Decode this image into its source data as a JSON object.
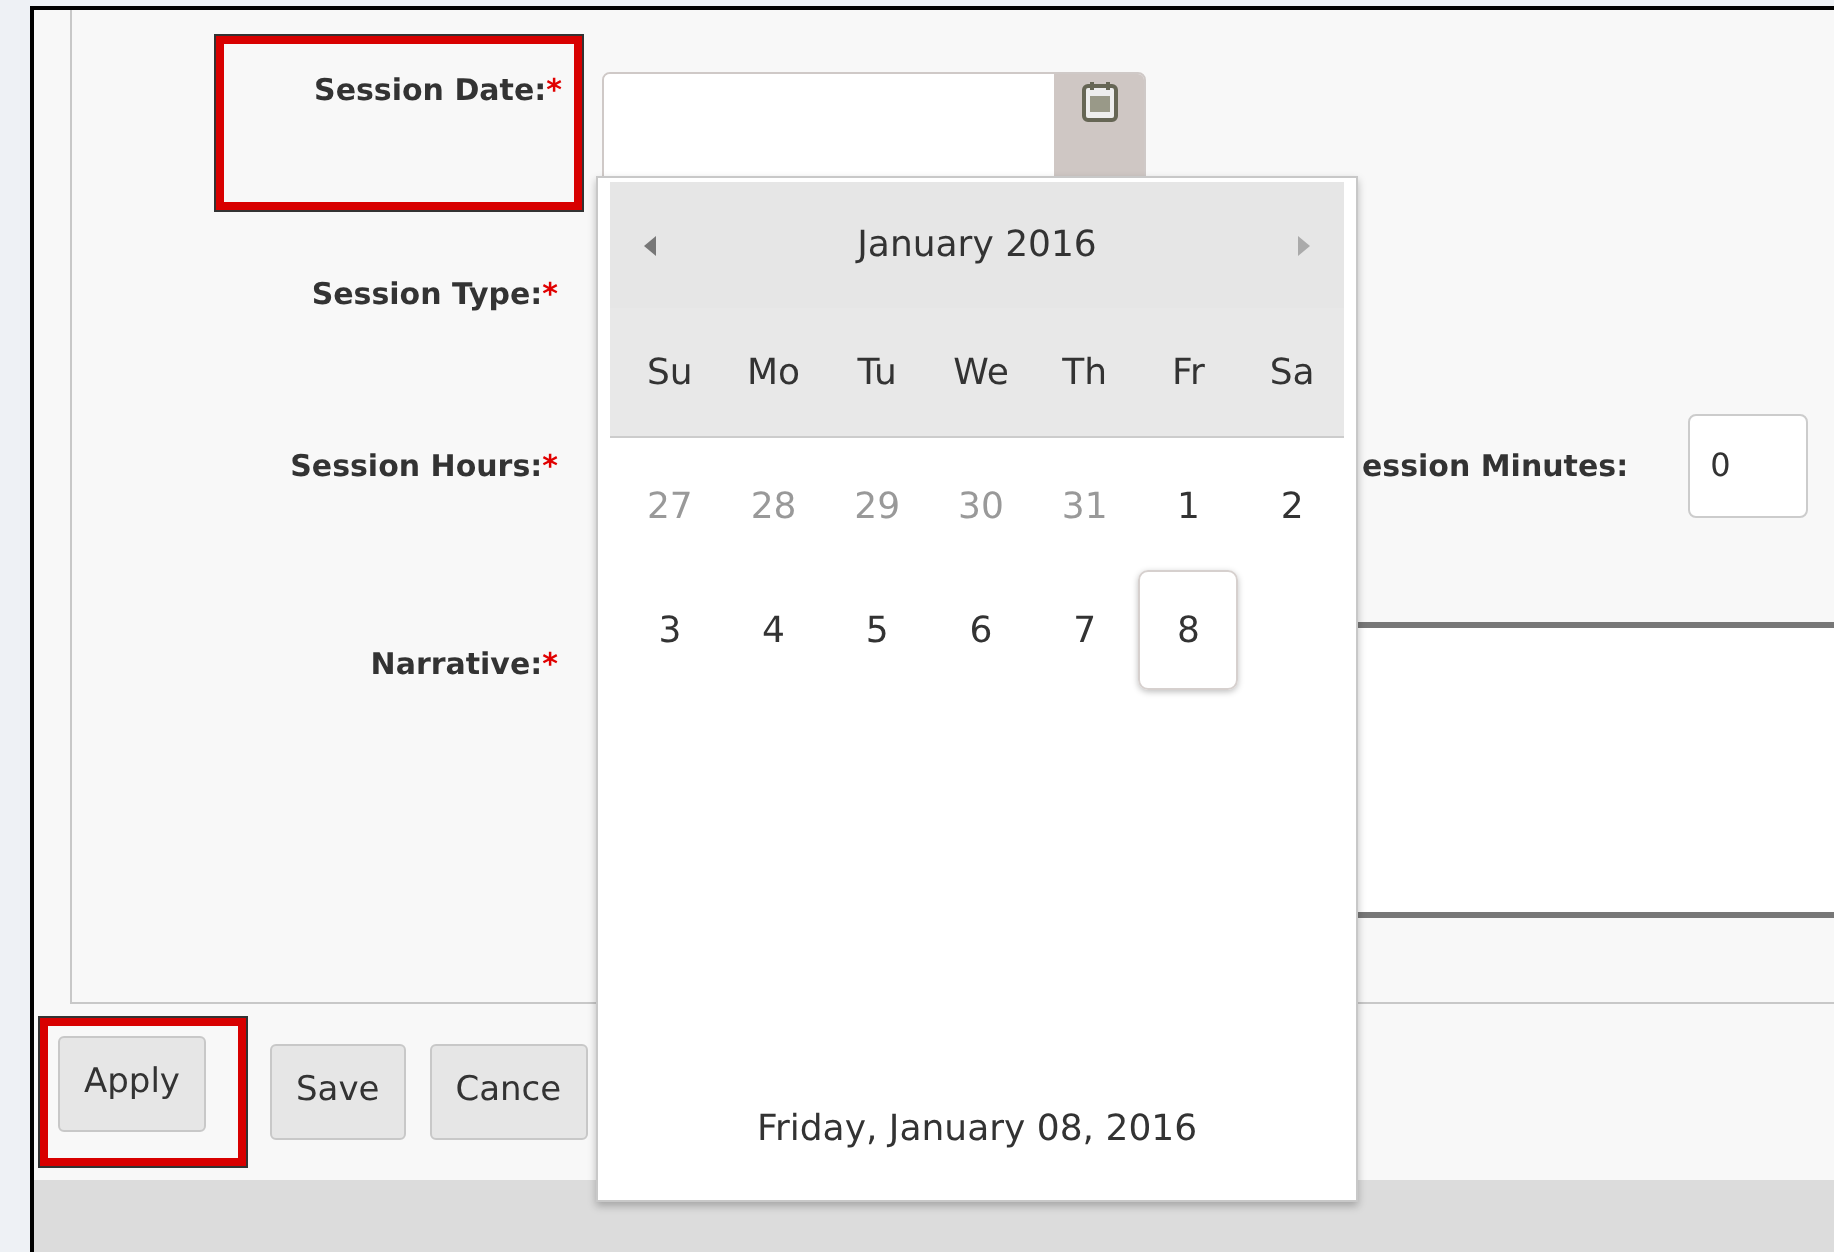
{
  "form": {
    "fields": [
      {
        "kind": "date",
        "label": "Session Date:",
        "required_mark": "*",
        "highlighted": true
      },
      {
        "kind": "covered",
        "label": "Session Type:",
        "required_mark": "*",
        "highlighted": false
      },
      {
        "kind": "hours",
        "label": "Session Hours:",
        "required_mark": "*",
        "highlighted": false,
        "minutes_label": "ession Minutes:",
        "minutes_value": "0"
      },
      {
        "kind": "textarea",
        "label": "Narrative:",
        "required_mark": "*",
        "highlighted": false
      }
    ]
  },
  "buttons": [
    {
      "label": "Apply",
      "highlighted": true
    },
    {
      "label": "Save",
      "highlighted": false
    },
    {
      "label": "Cance",
      "highlighted": false
    }
  ],
  "datepicker": {
    "title": "January 2016",
    "weekdays": [
      "Su",
      "Mo",
      "Tu",
      "We",
      "Th",
      "Fr",
      "Sa"
    ],
    "weeks": [
      [
        {
          "day": "27",
          "other_month": true,
          "selected": false
        },
        {
          "day": "28",
          "other_month": true,
          "selected": false
        },
        {
          "day": "29",
          "other_month": true,
          "selected": false
        },
        {
          "day": "30",
          "other_month": true,
          "selected": false
        },
        {
          "day": "31",
          "other_month": true,
          "selected": false
        },
        {
          "day": "1",
          "other_month": false,
          "selected": false
        },
        {
          "day": "2",
          "other_month": false,
          "selected": false
        }
      ],
      [
        {
          "day": "3",
          "other_month": false,
          "selected": false
        },
        {
          "day": "4",
          "other_month": false,
          "selected": false
        },
        {
          "day": "5",
          "other_month": false,
          "selected": false
        },
        {
          "day": "6",
          "other_month": false,
          "selected": false
        },
        {
          "day": "7",
          "other_month": false,
          "selected": false
        },
        {
          "day": "8",
          "other_month": false,
          "selected": true
        }
      ]
    ],
    "footer": "Friday, January 08, 2016"
  }
}
